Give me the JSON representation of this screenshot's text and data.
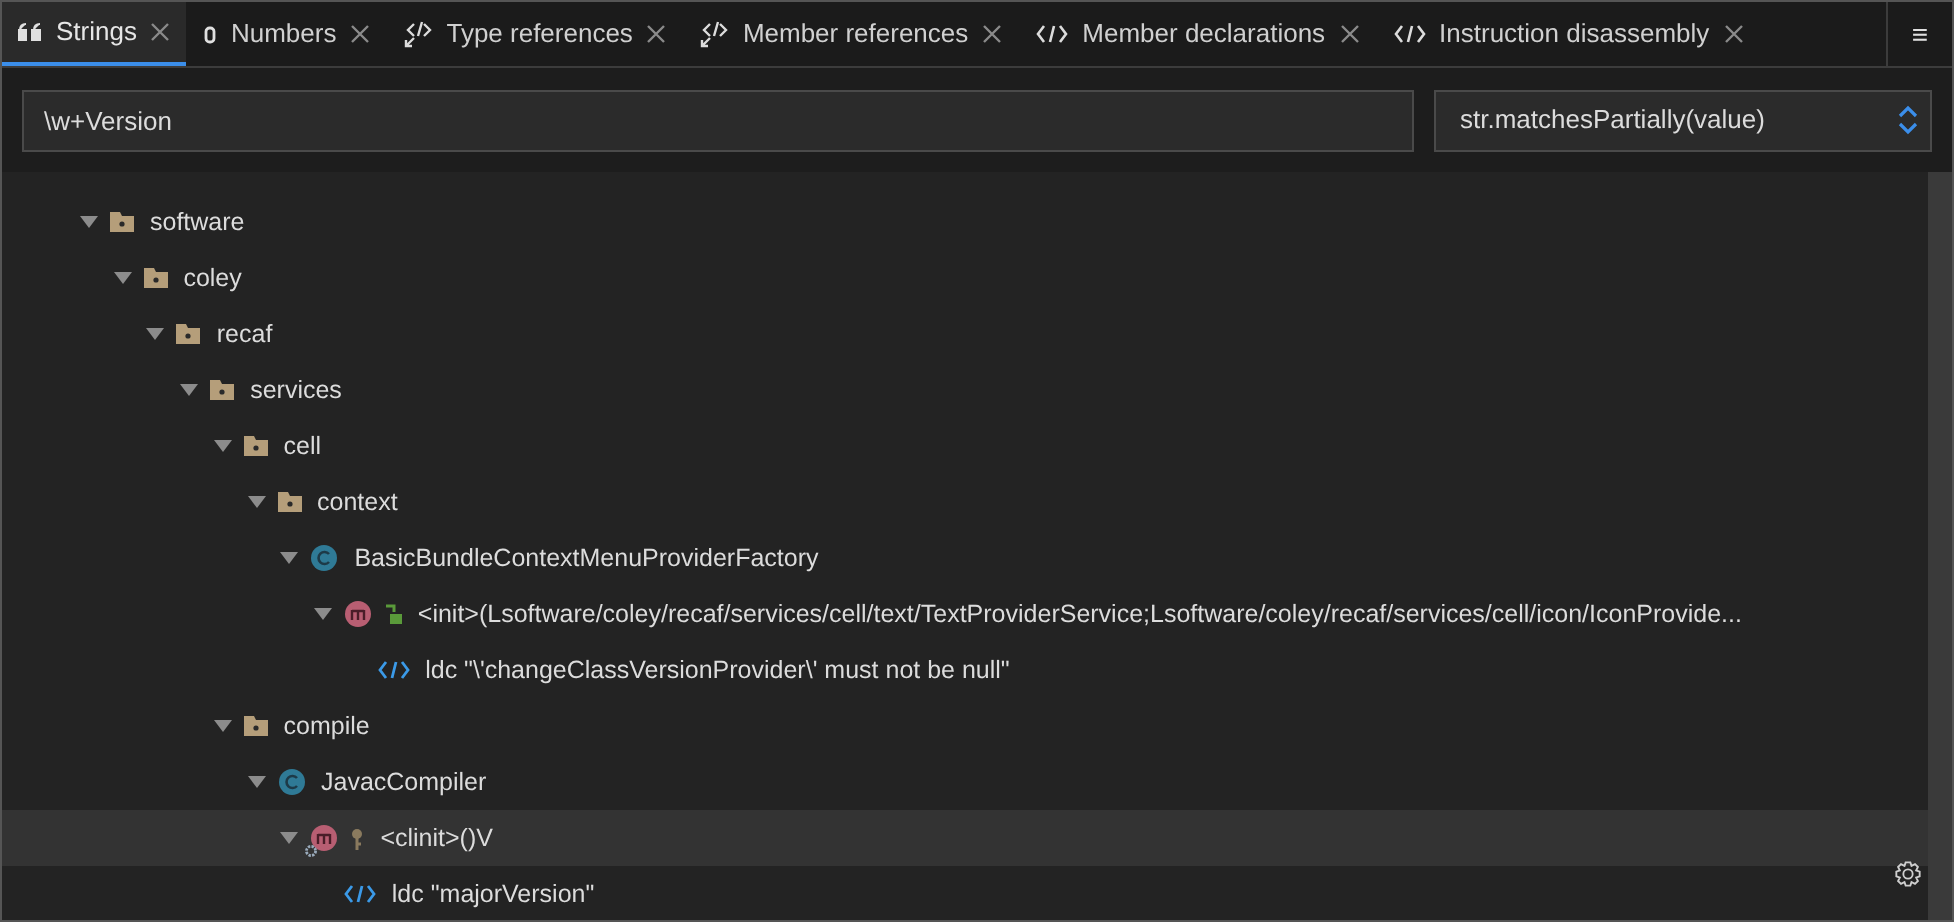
{
  "tabs": [
    {
      "label": "Strings",
      "kind": "strings",
      "selected": true
    },
    {
      "label": "Numbers",
      "kind": "numbers",
      "selected": false
    },
    {
      "label": "Type references",
      "kind": "reference",
      "selected": false
    },
    {
      "label": "Member references",
      "kind": "reference",
      "selected": false
    },
    {
      "label": "Member declarations",
      "kind": "declaration",
      "selected": false
    },
    {
      "label": "Instruction disassembly",
      "kind": "declaration",
      "selected": false
    }
  ],
  "menu_button": {
    "label": "≡"
  },
  "search": {
    "value": "\\w+Version"
  },
  "match_mode": {
    "value": "str.matchesPartially(value)"
  },
  "tree": [
    {
      "label": "software",
      "kind": "package",
      "expanded": true,
      "selected": false,
      "children": [
        {
          "label": "coley",
          "kind": "package",
          "expanded": true,
          "selected": false,
          "children": [
            {
              "label": "recaf",
              "kind": "package",
              "expanded": true,
              "selected": false,
              "children": [
                {
                  "label": "services",
                  "kind": "package",
                  "expanded": true,
                  "selected": false,
                  "children": [
                    {
                      "label": "cell",
                      "kind": "package",
                      "expanded": true,
                      "selected": false,
                      "children": [
                        {
                          "label": "context",
                          "kind": "package",
                          "expanded": true,
                          "selected": false,
                          "children": [
                            {
                              "label": "BasicBundleContextMenuProviderFactory",
                              "kind": "class",
                              "expanded": true,
                              "selected": false,
                              "children": [
                                {
                                  "label": "<init>(Lsoftware/coley/recaf/services/cell/text/TextProviderService;Lsoftware/coley/recaf/services/cell/icon/IconProvide...",
                                  "kind": "method",
                                  "public": true,
                                  "static": false,
                                  "expanded": true,
                                  "selected": false,
                                  "children": [
                                    {
                                      "label": "ldc \"\\'changeClassVersionProvider\\' must not be null\"",
                                      "kind": "instruction",
                                      "selected": false
                                    }
                                  ]
                                }
                              ]
                            }
                          ]
                        }
                      ]
                    },
                    {
                      "label": "compile",
                      "kind": "package",
                      "expanded": true,
                      "selected": false,
                      "children": [
                        {
                          "label": "JavacCompiler",
                          "kind": "class",
                          "expanded": true,
                          "selected": false,
                          "children": [
                            {
                              "label": "<clinit>()V",
                              "kind": "method",
                              "public": false,
                              "static": true,
                              "expanded": true,
                              "selected": true,
                              "children": [
                                {
                                  "label": "ldc \"majorVersion\"",
                                  "kind": "instruction",
                                  "selected": false
                                }
                              ]
                            }
                          ]
                        }
                      ]
                    }
                  ]
                }
              ]
            }
          ]
        }
      ]
    }
  ]
}
